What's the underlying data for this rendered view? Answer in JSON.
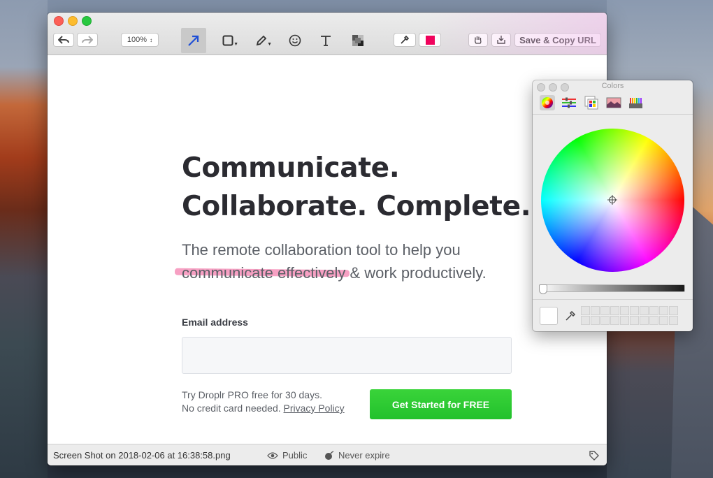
{
  "window": {
    "toolbar": {
      "zoom_label": "100%",
      "save_copy_label": "Save & Copy URL",
      "current_color": "#f0005a",
      "icons": [
        "undo-icon",
        "redo-icon",
        "arrow-tool-icon",
        "rectangle-tool-icon",
        "pen-tool-icon",
        "emoji-tool-icon",
        "text-tool-icon",
        "pixelate-tool-icon",
        "eyedropper-icon",
        "color-swatch",
        "hand-tool-icon",
        "download-icon"
      ]
    },
    "content": {
      "headline_line1": "Communicate.",
      "headline_line2": "Collaborate. Complete.",
      "subtitle_line1": "The remote collaboration tool to help you",
      "subtitle_line2": "communicate effectively & work productively.",
      "email_label": "Email address",
      "email_value": "",
      "trial_line1": "Try Droplr PRO free for 30 days.",
      "trial_line2_prefix": "No credit card needed. ",
      "privacy_link": "Privacy Policy",
      "cta_label": "Get Started for FREE",
      "cta_color": "#2ac72f",
      "highlight_color": "#f478aa"
    },
    "statusbar": {
      "filename": "Screen Shot on 2018-02-06 at 16:38:58.png",
      "visibility": "Public",
      "expiry": "Never expire"
    }
  },
  "colors_panel": {
    "title": "Colors",
    "tabs": [
      "color-wheel-icon",
      "sliders-icon",
      "palettes-icon",
      "image-palette-icon",
      "crayons-icon"
    ],
    "active_tab": "color-wheel-icon"
  }
}
